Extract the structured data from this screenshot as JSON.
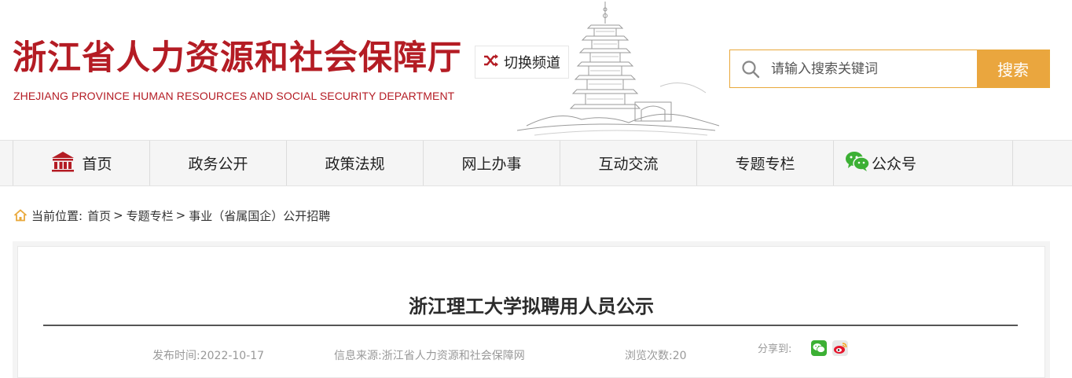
{
  "header": {
    "logo_cn": "浙江省人力资源和社会保障厅",
    "logo_en": "ZHEJIANG PROVINCE HUMAN RESOURCES AND SOCIAL SECURITY DEPARTMENT",
    "switch_channel_label": "切换频道",
    "search_placeholder": "请输入搜索关键词",
    "search_button_label": "搜索"
  },
  "nav": {
    "items": [
      {
        "label": "首页",
        "icon": "home-icon"
      },
      {
        "label": "政务公开"
      },
      {
        "label": "政策法规"
      },
      {
        "label": "网上办事"
      },
      {
        "label": "互动交流"
      },
      {
        "label": "专题专栏"
      },
      {
        "label": "公众号",
        "icon": "wechat-icon"
      }
    ]
  },
  "breadcrumb": {
    "label": "当前位置:",
    "items": [
      "首页",
      "专题专栏",
      "事业（省属国企）公开招聘"
    ],
    "separator": ">"
  },
  "article": {
    "title": "浙江理工大学拟聘用人员公示",
    "publish_time": "发布时间:2022-10-17",
    "source": "信息来源:浙江省人力资源和社会保障网",
    "views": "浏览次数:20",
    "share_label": "分享到:",
    "share_icons": [
      "wechat-icon",
      "weibo-icon"
    ]
  },
  "colors": {
    "brand_red": "#b41c24",
    "accent_orange": "#eaa63e",
    "nav_bg": "#f5f5f5",
    "wechat_green": "#3cb034",
    "weibo_red": "#e6162d"
  }
}
